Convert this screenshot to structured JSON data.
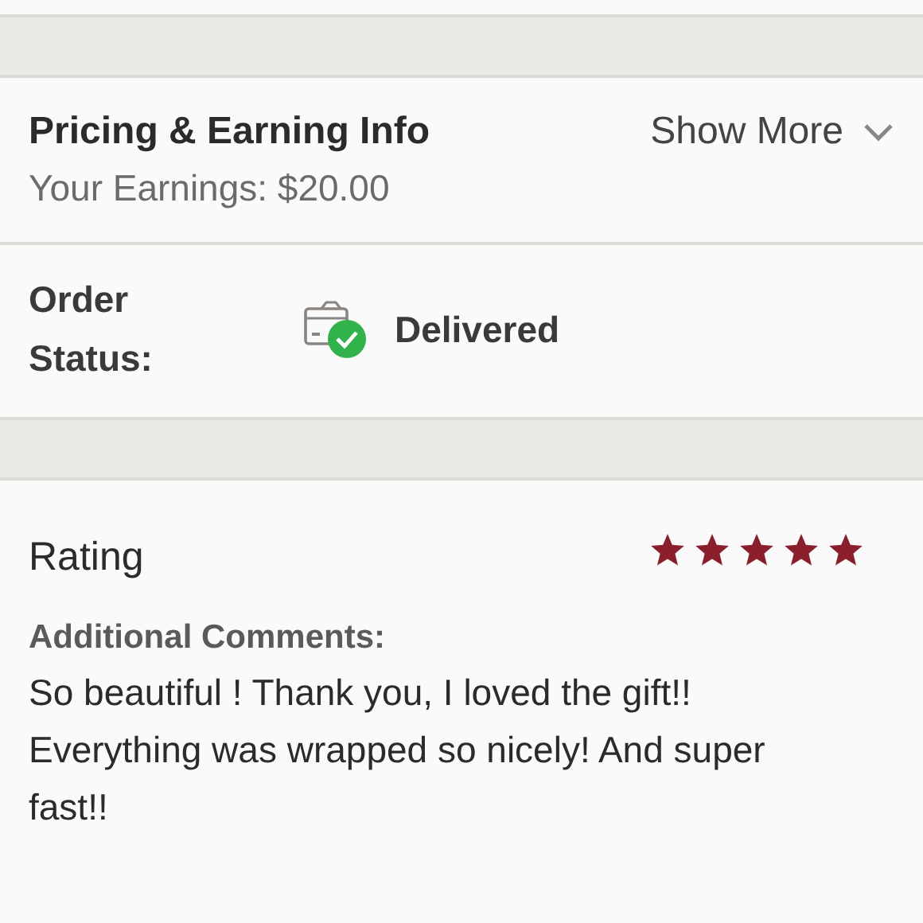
{
  "pricing": {
    "title": "Pricing & Earning Info",
    "toggle": {
      "label": "Show More",
      "expanded": false
    },
    "earnings": "Your Earnings: $20.00"
  },
  "order_status": {
    "label": "Order Status:",
    "value": "Delivered"
  },
  "rating": {
    "title": "Rating",
    "stars": 5,
    "comments_label": "Additional Comments:",
    "comments": "So beautiful ! Thank you, I loved the gift!! Everything was wrapped so nicely! And super fast!!"
  }
}
